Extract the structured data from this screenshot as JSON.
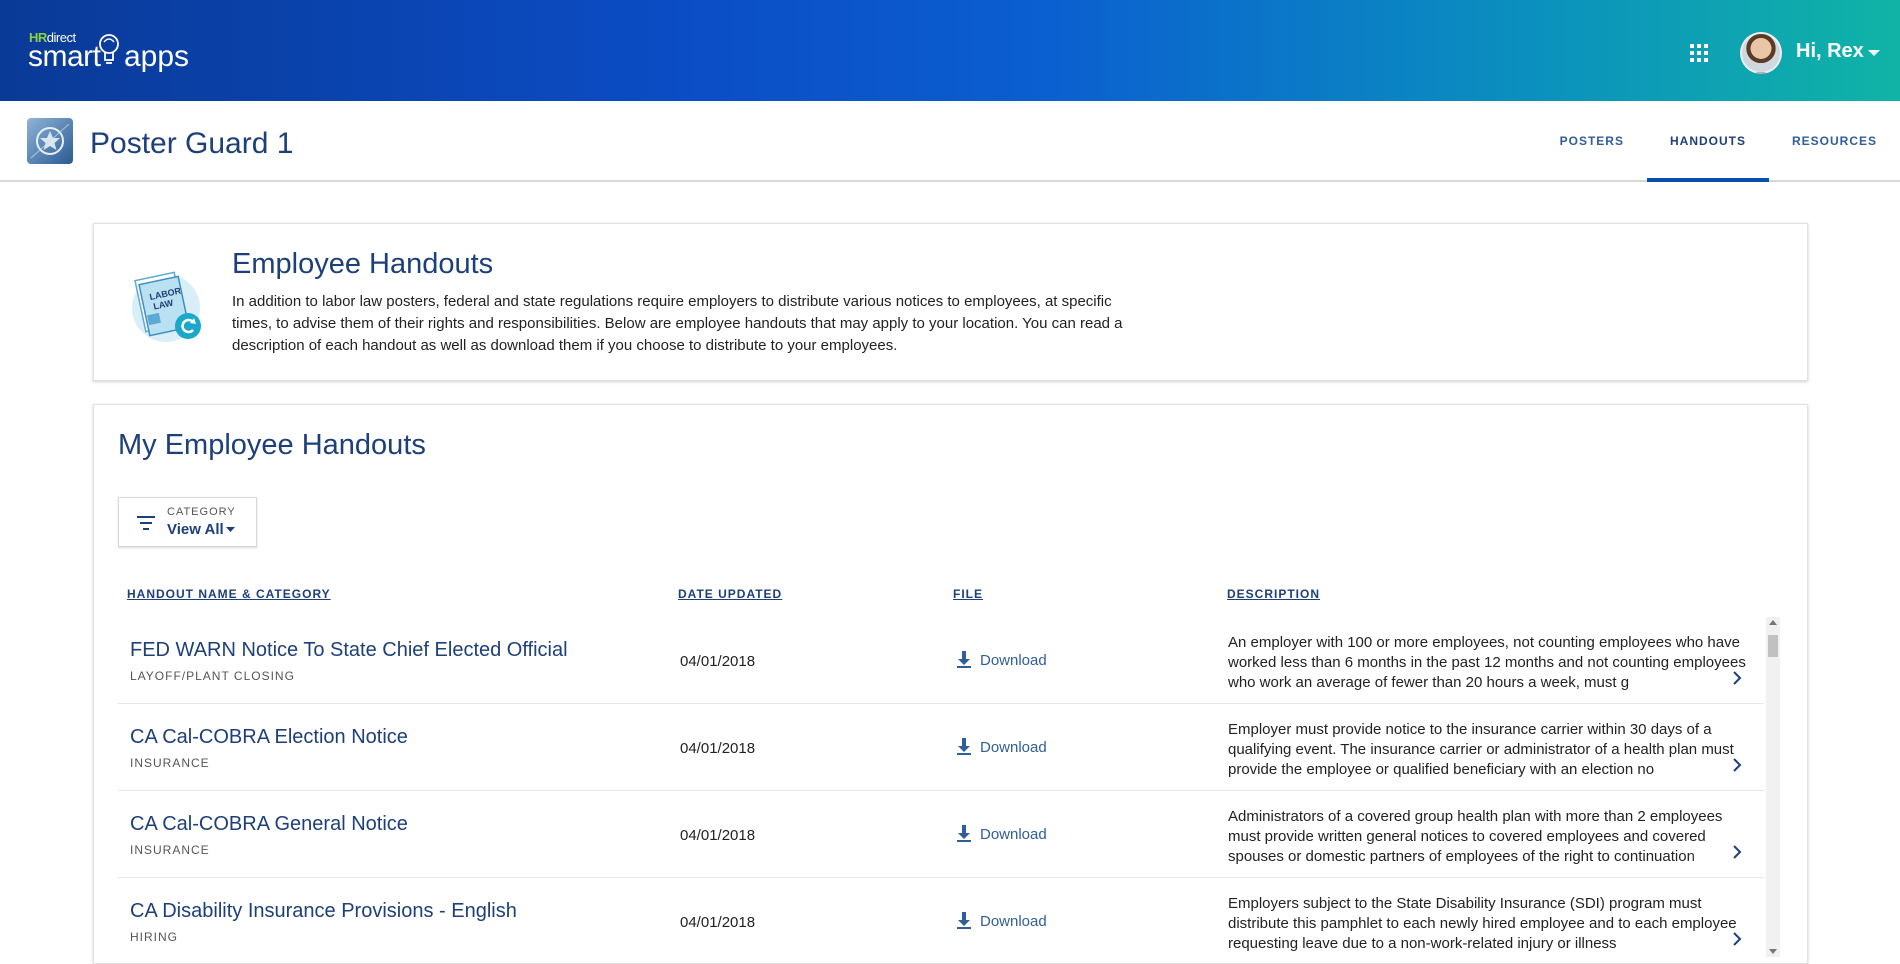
{
  "topbar": {
    "logo_hr": "HR",
    "logo_direct": "direct",
    "logo_smart": "smart",
    "logo_apps": "apps",
    "greeting": "Hi, Rex"
  },
  "appbar": {
    "title": "Poster Guard 1",
    "nav": [
      {
        "label": "POSTERS",
        "active": false
      },
      {
        "label": "HANDOUTS",
        "active": true
      },
      {
        "label": "RESOURCES",
        "active": false
      }
    ]
  },
  "intro": {
    "title": "Employee Handouts",
    "text": "In addition to labor law posters, federal and state regulations require employers to distribute various notices to employees, at specific times, to advise them of their rights and responsibilities. Below are employee handouts that may apply to your location. You can read a description of each handout as well as download them if you choose to distribute to your employees.",
    "icon_label": "LABOR LAW"
  },
  "handouts": {
    "title": "My Employee Handouts",
    "filter": {
      "label": "CATEGORY",
      "value": "View All"
    },
    "columns": {
      "name": "HANDOUT NAME & CATEGORY",
      "date": "DATE UPDATED",
      "file": "FILE",
      "description": "DESCRIPTION"
    },
    "rows": [
      {
        "name": "FED WARN Notice To State Chief Elected Official",
        "category": "LAYOFF/PLANT CLOSING",
        "date": "04/01/2018",
        "file": "Download",
        "description": "An employer with 100 or more employees, not counting employees who have worked less than 6 months in the past 12 months and not counting employees who work an average of fewer than 20 hours a week, must g"
      },
      {
        "name": "CA Cal-COBRA Election Notice",
        "category": "INSURANCE",
        "date": "04/01/2018",
        "file": "Download",
        "description": "Employer must provide notice to the insurance carrier within 30 days of a qualifying event. The insurance carrier or administrator of a health plan must provide the employee or qualified beneficiary with an election no"
      },
      {
        "name": "CA Cal-COBRA General Notice",
        "category": "INSURANCE",
        "date": "04/01/2018",
        "file": "Download",
        "description": "Administrators of a covered group health plan with more than 2 employees must provide written general notices to covered employees and covered spouses or domestic partners of employees of the right to continuation"
      },
      {
        "name": "CA Disability Insurance Provisions - English",
        "category": "HIRING",
        "date": "04/01/2018",
        "file": "Download",
        "description": "Employers subject to the State Disability Insurance (SDI) program must distribute this pamphlet to each newly hired employee and to each employee requesting leave due to a non-work-related injury or illness"
      }
    ]
  },
  "colors": {
    "brand_dark": "#0a3a97",
    "brand_teal": "#10b4a6",
    "heading_blue": "#1d3f7a",
    "link_blue": "#2f5e9a",
    "logo_green": "#8ed13f"
  },
  "icons": {
    "apps": "apps-grid-icon",
    "profile": "avatar",
    "filter": "filter-icon",
    "download": "download-icon",
    "more": "chevron-right-icon"
  }
}
